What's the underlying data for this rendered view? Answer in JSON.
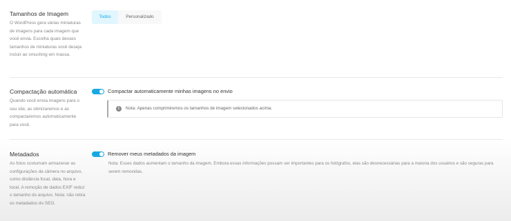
{
  "image_sizes": {
    "title": "Tamanhos de Imagem",
    "description": "O WordPress gera várias miniaturas de imagens para cada imagem que você envia. Escolha quais desses tamanhos de miniaturas você deseja incluir ao smushing em massa.",
    "tabs": [
      {
        "label": "Todos",
        "active": true
      },
      {
        "label": "Personalizado",
        "active": false
      }
    ]
  },
  "auto_compress": {
    "title": "Compactação automática",
    "description": "Quando você envia imagens para o seu site, as otimizaremos e as compactaremos automaticamente para você.",
    "toggle_label": "Compactar automaticamente minhas imagens no envio",
    "toggle_on": true,
    "notice_icon": "info-icon",
    "notice_text": "Nota: Apenas comprimiremos os tamanhos de imagem selecionados acima."
  },
  "metadata": {
    "title": "Metadados",
    "description": "As fotos costumam armazenar as configurações da câmera no arquivo, como distância focal, data, hora e local. A remoção de dados EXIF reduz o tamanho do arquivo. Nota: não retira os metadados do SEO.",
    "toggle_label": "Remover meus metadados da imagem",
    "toggle_on": true,
    "note_text": "Nota: Esses dados aumentam o tamanho da imagem. Embora essas informações possam ser importantes para os fotógrafos, elas são desnecessárias para a maioria dos usuários e são seguras para serem removidas."
  },
  "colors": {
    "accent": "#17a8e3",
    "active_tab_bg": "#e1f6ff"
  }
}
